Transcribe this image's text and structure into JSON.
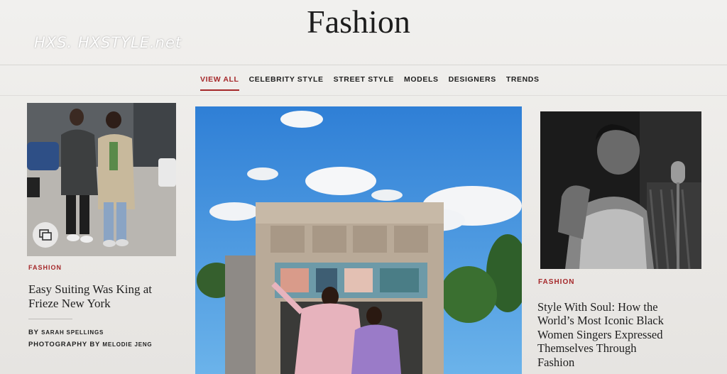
{
  "watermark": "HXS. HXSTYLE.net",
  "page_title": "Fashion",
  "nav": {
    "items": [
      "VIEW ALL",
      "CELEBRITY STYLE",
      "STREET STYLE",
      "MODELS",
      "DESIGNERS",
      "TRENDS"
    ],
    "active": "VIEW ALL"
  },
  "cards": {
    "left": {
      "kicker": "FASHION",
      "headline_line1": "Easy Suiting Was King at",
      "headline_line2": "Frieze New York",
      "byline_by": "BY",
      "byline_author": "SARAH SPELLINGS",
      "byline_photo": "PHOTOGRAPHY BY",
      "byline_photographer": "MELODIE JENG",
      "gallery_icon": "gallery-icon"
    },
    "center": {},
    "right": {
      "kicker": "FASHION",
      "headline_lines": [
        "Style With Soul: How the",
        "World’s Most Iconic Black",
        "Women Singers Expressed",
        "Themselves Through",
        "Fashion"
      ]
    }
  },
  "colors": {
    "accent": "#a5282a",
    "background": "#eceae8",
    "text": "#1e1e1e"
  }
}
